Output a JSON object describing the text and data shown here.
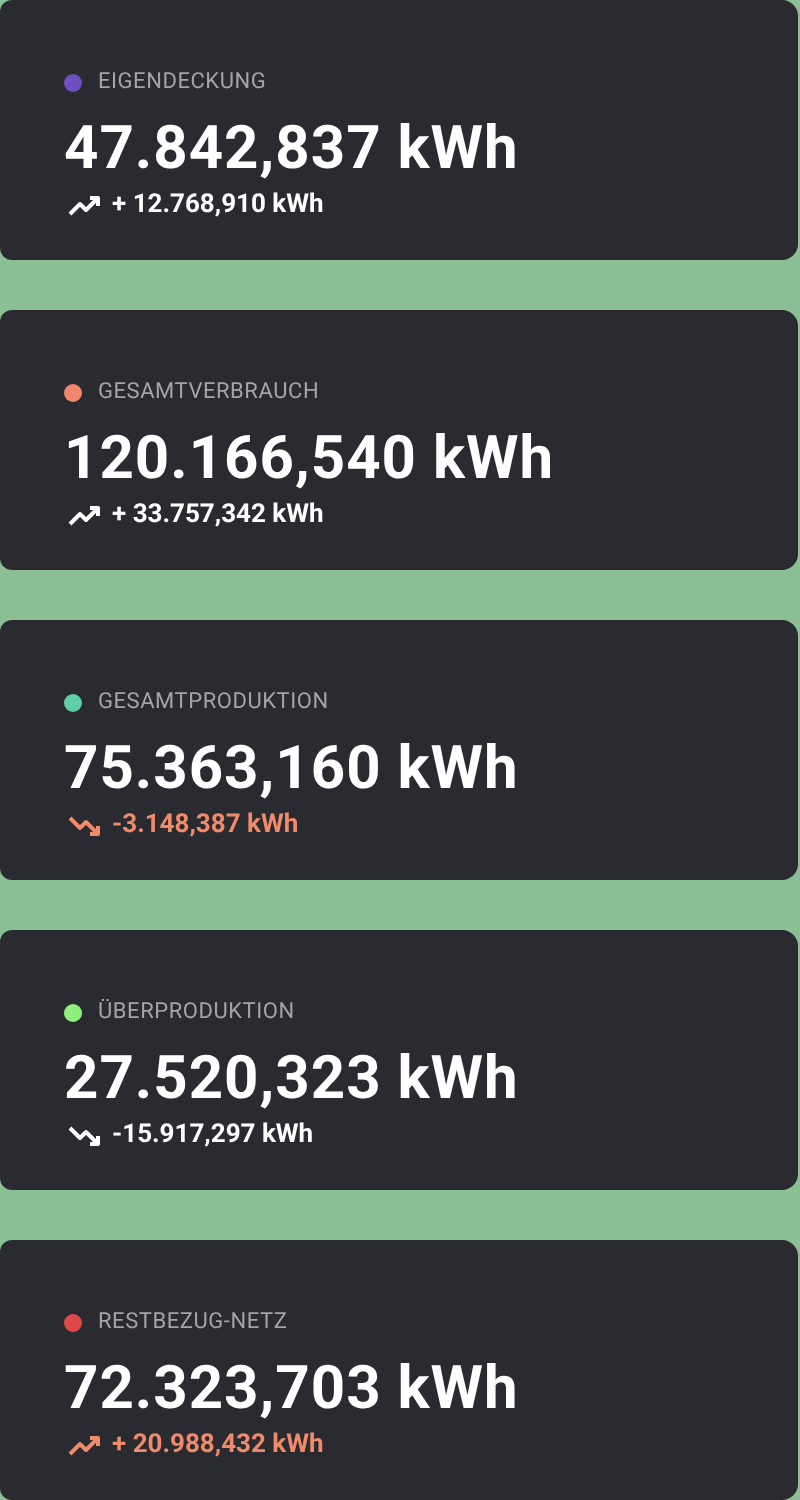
{
  "cards": [
    {
      "label": "EIGENDECKUNG",
      "color": "#6f4fc0",
      "value": "47.842,837 kWh",
      "trend": {
        "kind": "up",
        "alert": false,
        "text": "+ 12.768,910 kWh"
      }
    },
    {
      "label": "GESAMTVERBRAUCH",
      "color": "#f0866a",
      "value": "120.166,540 kWh",
      "trend": {
        "kind": "up",
        "alert": false,
        "text": "+ 33.757,342 kWh"
      }
    },
    {
      "label": "GESAMTPRODUKTION",
      "color": "#5fcfa8",
      "value": "75.363,160 kWh",
      "trend": {
        "kind": "down",
        "alert": true,
        "text": "-3.148,387 kWh"
      }
    },
    {
      "label": "ÜBERPRODUKTION",
      "color": "#8ef07a",
      "value": "27.520,323 kWh",
      "trend": {
        "kind": "down",
        "alert": false,
        "text": "-15.917,297 kWh"
      }
    },
    {
      "label": "RESTBEZUG-NETZ",
      "color": "#e04848",
      "value": "72.323,703 kWh",
      "trend": {
        "kind": "up",
        "alert": true,
        "text": "+ 20.988,432 kWh"
      }
    }
  ]
}
